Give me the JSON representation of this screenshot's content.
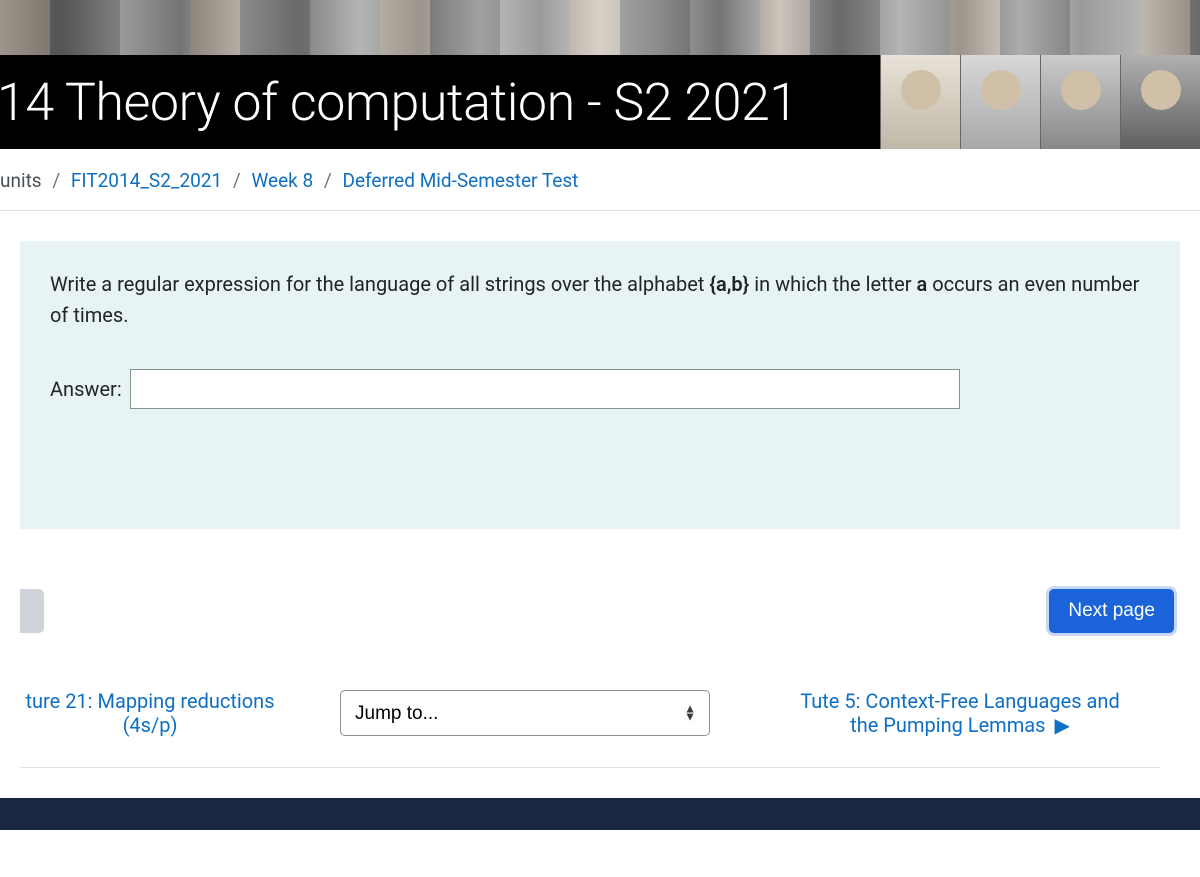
{
  "header": {
    "course_title": "14 Theory of computation - S2 2021"
  },
  "breadcrumb": {
    "item0": "units",
    "item1": "FIT2014_S2_2021",
    "item2": "Week 8",
    "item3": "Deferred Mid-Semester Test"
  },
  "question": {
    "pre": "Write a regular expression for the language of all strings over the alphabet  ",
    "alphabet": "{a,b}",
    "mid": "  in which  the letter ",
    "letter": " a ",
    "post": " occurs an even number of times.",
    "answer_label": "Answer:",
    "answer_value": ""
  },
  "pager": {
    "next_label": "Next page"
  },
  "bottom_nav": {
    "prev_label_line1": "ture 21: Mapping reductions",
    "prev_label_line2": "(4s/p)",
    "jump_placeholder": "Jump to...",
    "next_label_line1": "Tute 5:  Context-Free Languages and",
    "next_label_line2": "the Pumping Lemmas",
    "next_caret": "▶"
  }
}
